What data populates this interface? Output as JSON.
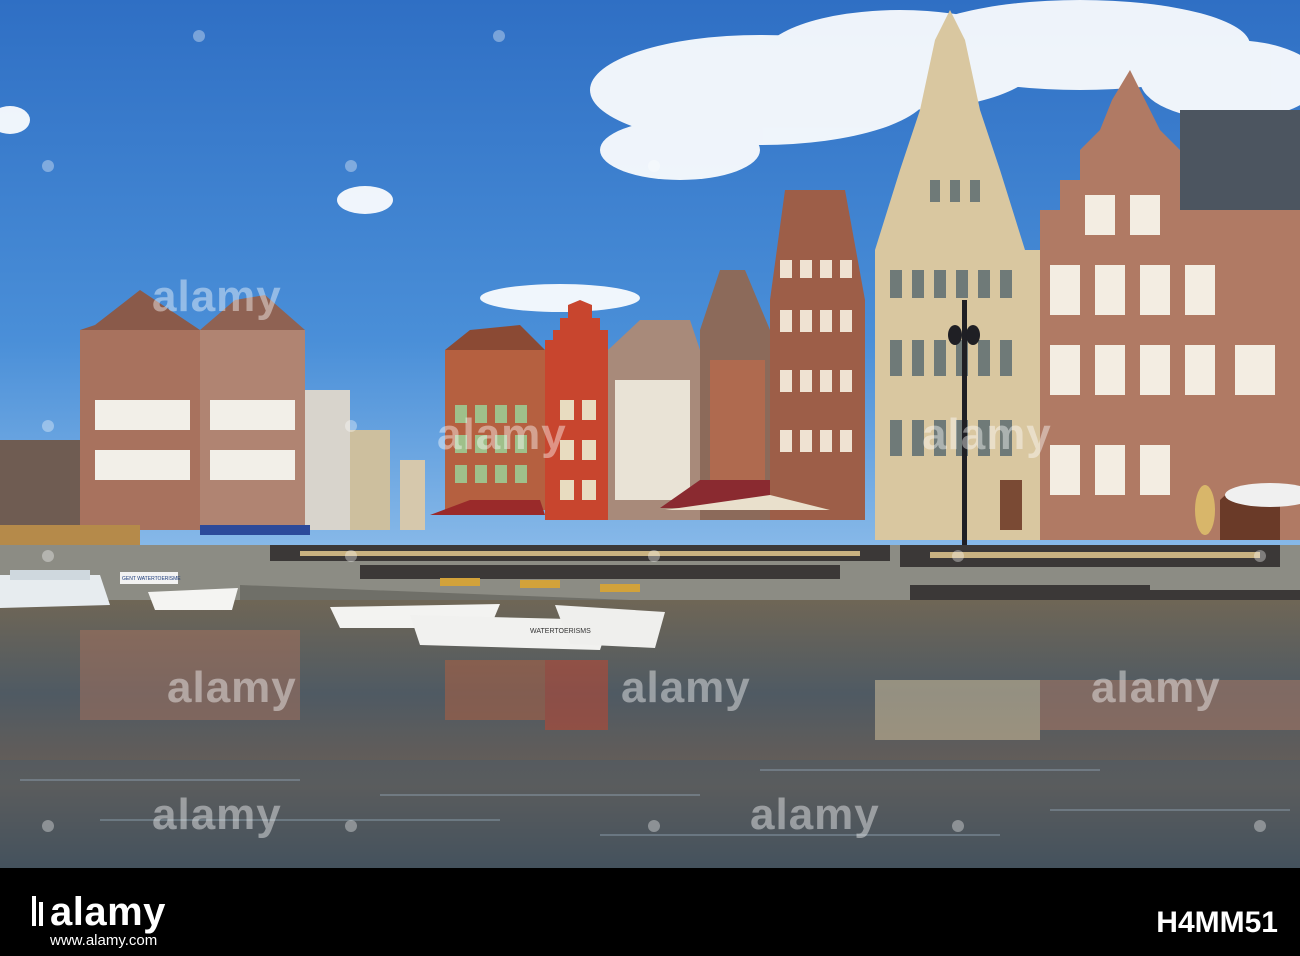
{
  "photo": {
    "scene": "",
    "colors": {
      "sky": "#3a7fd0",
      "sky_light": "#8fc0ee",
      "water": "#4d5a66",
      "brick": "#9c5a46",
      "red_house": "#c8452e",
      "stone": "#d9c7a0",
      "quay": "#8c8c84"
    },
    "boat_label": "WATERTOERISMS",
    "sign_text": "GENT WATERTOERISME"
  },
  "watermark": {
    "text": "alamy"
  },
  "footer": {
    "brand": "alamy",
    "image_id": "H4MM51",
    "url": "www.alamy.com"
  }
}
